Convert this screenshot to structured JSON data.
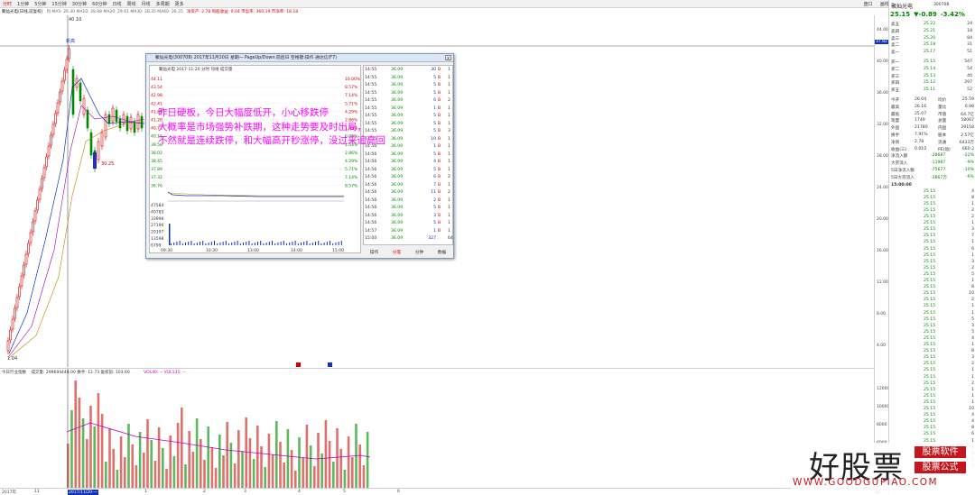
{
  "toolbar": {
    "left_items": [
      "分时",
      "1分钟",
      "5分钟",
      "15分钟",
      "30分钟",
      "60分钟",
      "日线",
      "周线",
      "月线",
      "多周期",
      "更多"
    ],
    "active_index": 0,
    "right_items": [
      "盘口",
      "画线",
      "统计",
      "叠加",
      "F10",
      "返回"
    ]
  },
  "info_row": {
    "chart_title": "聚灿光电(日线,前复权)",
    "ma": "均 MA5: 26.30 MA10: 28.98 MA20: 29.61 MA30: 28.35 MA60: 26.25",
    "extra_1": "净资产: 2.78 每股收益: 0.04 市盈率: 360.19 市净率: 18.18"
  },
  "colors": {
    "up": "#d00000",
    "down": "#008800",
    "line": "#1030c0",
    "watermark_red": "#c4161c",
    "overlay": "#ff00ff"
  },
  "main_chart": {
    "annotation_top": "40.10",
    "annotation_high_label": "新高",
    "annotation_low": "1.04",
    "annotation_mid": "30.25",
    "price_marker": "37.82",
    "y_ticks": [
      "44.00",
      "40.00",
      "36.00",
      "32.00",
      "28.00",
      "24.00",
      "20.00",
      "16.00",
      "12.00",
      "8.00",
      "4.00"
    ]
  },
  "vol_chart": {
    "header_label": "今日行业指数",
    "vol_text": "成交量: 299694448.00 换手: 12.73 复权前: 103.60",
    "vol_legend": "VOL40: -- VOL135: --",
    "y_ticks": [
      "12000",
      "10000",
      "8000",
      "6000",
      "4000",
      "2000"
    ]
  },
  "date_axis": {
    "labels": [
      "2017年",
      "11",
      "2017/11/20-一",
      "1",
      "2",
      "3",
      "4",
      "5",
      "6"
    ],
    "right_label": "日线"
  },
  "dialog": {
    "title": "聚灿光电(300708) 2017年11月20日 星期一 PageUp/Down:前后日 空格键:操作 通达信(F7)",
    "subheader": "聚灿光电 2017-11-20 分时 均线 成交量",
    "close_label": "x",
    "left_price_ticks": [
      "44.11",
      "43.54",
      "42.98",
      "42.41",
      "41.85",
      "41.28",
      "40.72",
      "40.15",
      "39.58",
      "39.02",
      "38.45",
      "37.89",
      "37.32",
      "36.76"
    ],
    "right_pct_ticks": [
      "10.00%",
      "8.57%",
      "7.14%",
      "5.71%",
      "4.29%",
      "2.86%",
      "1.43%",
      "0.00%",
      "1.43%",
      "2.86%",
      "4.29%",
      "5.71%",
      "7.14%",
      "8.57%"
    ],
    "vol_ticks": [
      "47584",
      "40785",
      "33996",
      "27196",
      "20397",
      "13598",
      "6799"
    ],
    "time_labels": [
      "09:30",
      "10:30",
      "13:00",
      "14:00",
      "15:00"
    ],
    "ticks": [
      [
        "14:55",
        "36.09",
        "30",
        "B",
        "1"
      ],
      [
        "14:55",
        "36.09",
        "5",
        "B",
        "1"
      ],
      [
        "14:55",
        "36.09",
        "5",
        "B",
        "1"
      ],
      [
        "14:55",
        "36.09",
        "5",
        "B",
        "1"
      ],
      [
        "14:55",
        "36.09",
        "6",
        "B",
        "2"
      ],
      [
        "14:55",
        "36.09",
        "1",
        "B",
        "1"
      ],
      [
        "14:55",
        "36.09",
        "5",
        "B",
        "1"
      ],
      [
        "14:55",
        "36.09",
        "5",
        "B",
        "1"
      ],
      [
        "14:55",
        "36.09",
        "5",
        "B",
        "3"
      ],
      [
        "14:55",
        "36.09",
        "10",
        "B",
        "1"
      ],
      [
        "14:56",
        "36.09",
        "1",
        "B",
        "1"
      ],
      [
        "14:56",
        "36.09",
        "5",
        "B",
        "1"
      ],
      [
        "14:56",
        "36.09",
        "4",
        "B",
        "1"
      ],
      [
        "14:56",
        "36.09",
        "5",
        "B",
        "1"
      ],
      [
        "14:56",
        "36.09",
        "6",
        "B",
        "2"
      ],
      [
        "14:56",
        "36.09",
        "7",
        "B",
        "1"
      ],
      [
        "14:56",
        "36.09",
        "11",
        "B",
        "2"
      ],
      [
        "14:56",
        "36.09",
        "2",
        "B",
        "1"
      ],
      [
        "14:56",
        "36.09",
        "5",
        "B",
        "1"
      ],
      [
        "14:56",
        "36.09",
        "3",
        "B",
        "1"
      ],
      [
        "14:56",
        "36.09",
        "5",
        "B",
        "1"
      ],
      [
        "14:57",
        "36.09",
        "1",
        "B",
        "1"
      ],
      [
        "15:00",
        "36.09",
        "327",
        "",
        "64"
      ]
    ],
    "bottom_buttons": [
      "分笔",
      "分钟",
      "数据"
    ],
    "left_bottom_label": "操作"
  },
  "overlay": {
    "lines": [
      "昨日硬板，今日大幅度低开，小心移跌停",
      "大概率是市场强势补跌期，这种走势要及时出局，",
      "不然就是连续跌停，和大幅高开秒涨停，没过来追高回"
    ]
  },
  "panel": {
    "stock_name": "聚灿光电",
    "stock_code": "300708",
    "price": "25.15",
    "change": "▼-0.89",
    "change_pct": "-3.42%",
    "sell_rows": [
      [
        "卖五",
        "25.22",
        "24"
      ],
      [
        "卖四",
        "25.21",
        "18"
      ],
      [
        "卖三",
        "25.20",
        "84"
      ],
      [
        "卖二",
        "25.18",
        "31"
      ],
      [
        "卖一",
        "25.17",
        "51"
      ]
    ],
    "buy_rows": [
      [
        "买一",
        "25.15",
        "547"
      ],
      [
        "买二",
        "25.14",
        "54"
      ],
      [
        "买三",
        "25.13",
        "40"
      ],
      [
        "买四",
        "25.12",
        "297"
      ],
      [
        "买五",
        "25.11",
        "52"
      ]
    ],
    "stats": [
      [
        "今开",
        "26.04",
        "均价",
        "25.59"
      ],
      [
        "最高",
        "26.16",
        "量比",
        "0.98"
      ],
      [
        "最低",
        "25.07",
        "市值",
        "64.7亿"
      ],
      [
        "现量",
        "1749",
        "总量",
        "58067"
      ],
      [
        "外盘",
        "21780",
        "内盘",
        "29158"
      ],
      [
        "换手",
        "7.91%",
        "股本",
        "2.57亿"
      ],
      [
        "净资",
        "2.78",
        "流通",
        "6433万"
      ],
      [
        "收益(三)",
        "0.010",
        "PE(动)",
        "660.2"
      ]
    ],
    "flows": [
      [
        "净流入额",
        "-28687",
        "-22%"
      ],
      [
        "大宗流入",
        "-11987",
        "-9%"
      ],
      [
        "5日净流入额",
        "-75677",
        "-10%"
      ],
      [
        "5日大宗流入",
        "-2867万",
        "-6%"
      ]
    ],
    "trade_header": "15:00:00",
    "trades": [
      [
        "25.15",
        "4"
      ],
      [
        "25.15",
        "8"
      ],
      [
        "25.15",
        "1"
      ],
      [
        "25.15",
        "2"
      ],
      [
        "25.15",
        "2"
      ],
      [
        "25.15",
        "1"
      ],
      [
        "25.15",
        "3"
      ],
      [
        "25.15",
        "7"
      ],
      [
        "25.15",
        "1"
      ],
      [
        "25.15",
        "6"
      ],
      [
        "25.15",
        "1"
      ],
      [
        "25.15",
        "3"
      ],
      [
        "25.15",
        "2"
      ],
      [
        "25.15",
        "5"
      ],
      [
        "25.15",
        "1"
      ],
      [
        "25.15",
        "8"
      ],
      [
        "25.15",
        "10"
      ],
      [
        "25.15",
        "2"
      ],
      [
        "25.15",
        "1"
      ],
      [
        "25.15",
        "1"
      ],
      [
        "25.15",
        "5"
      ],
      [
        "25.15",
        "3"
      ],
      [
        "25.15",
        "5"
      ],
      [
        "25.15",
        "4"
      ],
      [
        "25.15",
        "1"
      ],
      [
        "25.15",
        "8"
      ],
      [
        "25.15",
        "3"
      ],
      [
        "25.15",
        "2"
      ],
      [
        "25.15",
        "1"
      ],
      [
        "25.15",
        "1"
      ],
      [
        "25.15",
        "2"
      ],
      [
        "25.15",
        "1"
      ],
      [
        "25.15",
        "1"
      ],
      [
        "25.15",
        "1"
      ],
      [
        "25.15",
        "10"
      ],
      [
        "25.15",
        "4"
      ],
      [
        "25.15",
        "4"
      ],
      [
        "25.15",
        "8"
      ],
      [
        "25.15",
        "6"
      ],
      [
        "25.15",
        "1"
      ],
      [
        "25.15",
        "1"
      ],
      [
        "25.15",
        "6"
      ],
      [
        "25.15",
        "5"
      ],
      [
        "25.15",
        "2"
      ]
    ],
    "trade_row_index_labels": [
      "4",
      "11",
      "14",
      "13",
      "15",
      "19",
      "22",
      "22",
      "25",
      "28",
      "28",
      "29",
      "31",
      "31",
      "33",
      "39",
      "41",
      "41",
      "42",
      "43",
      "44",
      "45",
      "46",
      "46",
      "47",
      "48",
      "49",
      "50",
      "51",
      "51",
      "52",
      "54",
      "55",
      "57",
      "58",
      "59",
      "59"
    ],
    "bottom_label": "日线"
  },
  "watermark": {
    "big": "好股票",
    "tag1": "股票软件",
    "tag2": "股票公式",
    "url": "WWW.GOODGUPIAO.COM"
  }
}
